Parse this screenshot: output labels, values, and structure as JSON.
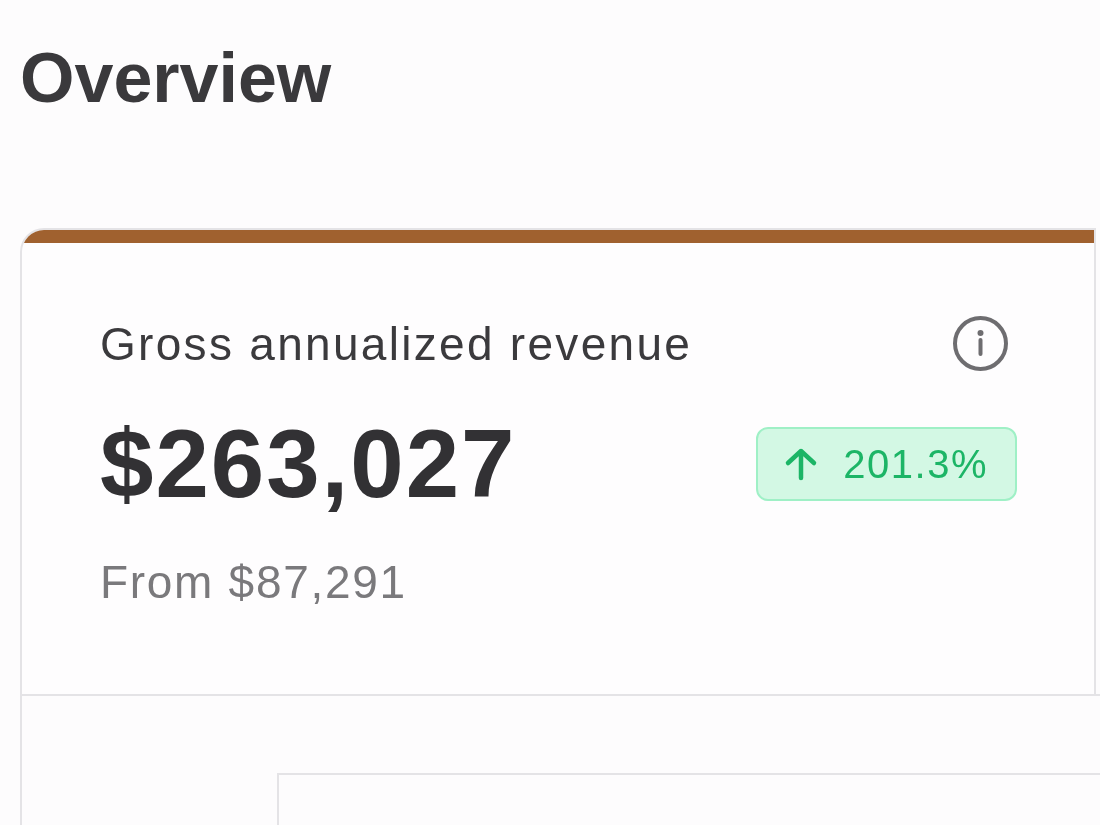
{
  "page": {
    "title": "Overview"
  },
  "metric_card": {
    "label": "Gross annualized revenue",
    "value": "$263,027",
    "change": {
      "increase": true,
      "text": "201.3%"
    },
    "comparison": "From $87,291"
  }
}
